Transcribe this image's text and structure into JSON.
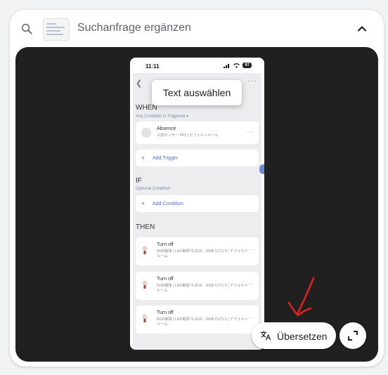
{
  "search": {
    "query_label": "Suchanfrage ergänzen",
    "search_icon": "search-icon",
    "collapse_icon": "chevron-up-icon"
  },
  "phone": {
    "status_time": "11:11",
    "battery": "97",
    "tooltip": "Text auswählen",
    "when_label": "WHEN",
    "when_sub": "Any Condition is Triggered ▾",
    "absence_title": "Absence",
    "absence_desc": "人感センサー FP2 | デフォルトルーム",
    "add_trigger": "Add Trigger",
    "if_label": "IF",
    "if_sub": "Optional Condition",
    "add_condition": "Add Condition",
    "then_label": "THEN",
    "actions": [
      {
        "title": "Turn off",
        "desc": "RGB電球 | LED電球T2 (E26、RGB CCT)-3 | デフォルトルーム"
      },
      {
        "title": "Turn off",
        "desc": "RGB電球 | LED電球T2 (E26、RGB CCT)-2 | デフォルトルーム"
      },
      {
        "title": "Turn off",
        "desc": "RGB電球 | LED電球T2 (E26、RGB CCT)-1 | デフォルトルーム"
      }
    ]
  },
  "actions": {
    "translate_label": "Übersetzen",
    "translate_icon": "translate-icon",
    "expand_icon": "expand-icon"
  },
  "colors": {
    "viewer_bg": "#202020",
    "link": "#5b6fd0",
    "annotation_red": "#e0201a"
  }
}
